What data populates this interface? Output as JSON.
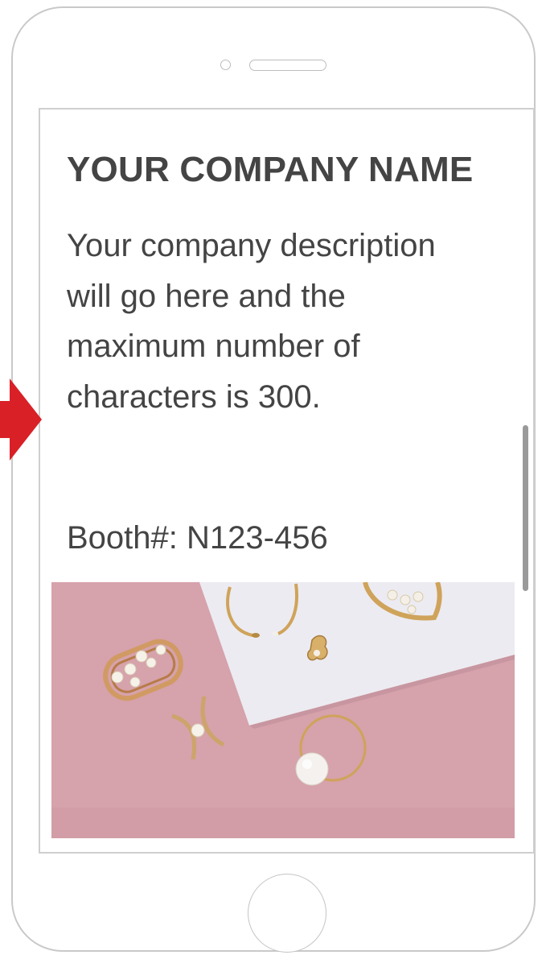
{
  "company": {
    "name": "YOUR COMPANY NAME",
    "description": "Your company description will go here and the maximum number of characters is 300.",
    "booth": "Booth#: N123-456"
  },
  "colors": {
    "arrow": "#d92027",
    "text": "#444444",
    "photo_background": "#d6a2ab",
    "paper": "#ecebf1",
    "gold": "#cfa35a"
  },
  "icons": {
    "arrow": "right-arrow-icon"
  }
}
